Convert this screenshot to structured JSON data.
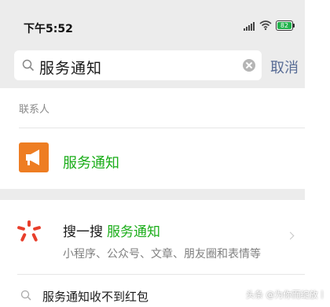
{
  "status_bar": {
    "time": "下午5:52",
    "battery": "82",
    "battery_color": "#22b14c"
  },
  "search": {
    "query": "服务通知",
    "cancel_label": "取消"
  },
  "contacts_section": {
    "label": "联系人",
    "items": [
      {
        "name": "服务通知",
        "avatar_color": "#ee7d22",
        "icon": "megaphone-icon"
      }
    ]
  },
  "sousou": {
    "title": "搜一搜",
    "keyword": "服务通知",
    "subtitle": "小程序、公众号、文章、朋友圈和表情等",
    "icon": "sousou-icon",
    "icon_color": "#e83e2b"
  },
  "suggestion": {
    "text": "服务通知收不到红包"
  },
  "watermark": {
    "text": "头条 @为你而绽放丨"
  },
  "colors": {
    "accent_green": "#1aad19",
    "link_blue": "#576b95",
    "header_gray": "#ececec"
  }
}
